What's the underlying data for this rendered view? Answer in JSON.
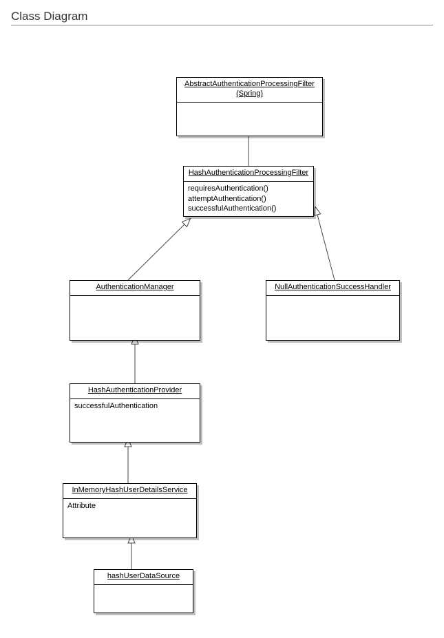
{
  "page_title": "Class Diagram",
  "classes": {
    "abstract_filter": {
      "name_line1": "AbstractAuthenticationProcessingFilter",
      "name_line2": "(Spring)"
    },
    "hash_filter": {
      "name": "HashAuthenticationProcessingFilter",
      "op1": "requiresAuthentication()",
      "op2": "attemptAuthentication()",
      "op3": "successfulAuthentication()"
    },
    "auth_manager": {
      "name": "AuthenticationManager"
    },
    "null_handler": {
      "name": "NullAuthenticationSuccessHandler"
    },
    "hash_provider": {
      "name": "HashAuthenticationProvider",
      "attr": "successfulAuthentication"
    },
    "inmem_service": {
      "name": "InMemoryHashUserDetailsService",
      "attr": "Attribute"
    },
    "data_source": {
      "name": "hashUserDataSource"
    }
  }
}
